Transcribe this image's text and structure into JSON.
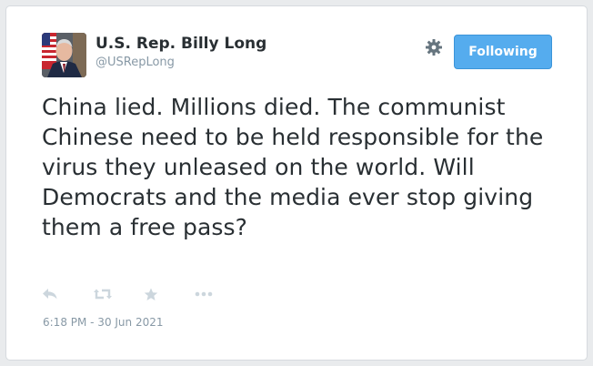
{
  "tweet": {
    "author": {
      "name": "U.S. Rep. Billy Long",
      "handle": "@USRepLong",
      "avatar_icon": "profile-photo-with-flag"
    },
    "follow_button_label": "Following",
    "text": "China lied. Millions died. The communist Chinese need to be held responsible for the virus they unleased on the world. Will Democrats and the media ever stop giving them a free pass?",
    "timestamp": "6:18 PM - 30 Jun 2021",
    "actions": [
      {
        "icon": "reply-icon"
      },
      {
        "icon": "retweet-icon"
      },
      {
        "icon": "favorite-star-icon"
      },
      {
        "icon": "more-dots-icon"
      }
    ],
    "settings_icon": "gear-icon"
  },
  "colors": {
    "accent": "#55acee",
    "text": "#292f33",
    "muted": "#8899a6",
    "icon": "#ccd6dd"
  }
}
